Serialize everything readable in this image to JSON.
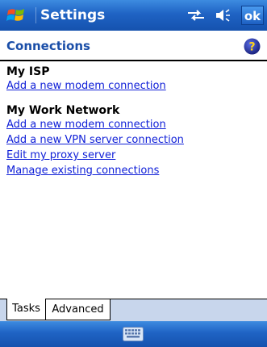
{
  "titlebar": {
    "title": "Settings",
    "start_icon": "windows-flag-icon",
    "ok_label": "ok"
  },
  "header": {
    "title": "Connections",
    "help_icon": "help-icon"
  },
  "groups": [
    {
      "title": "My ISP",
      "links": [
        "Add a new modem connection"
      ]
    },
    {
      "title": "My Work Network",
      "links": [
        "Add a new modem connection",
        "Add a new VPN server connection",
        "Edit my proxy server",
        "Manage existing connections"
      ]
    }
  ],
  "tabs": [
    {
      "label": "Tasks",
      "active": true
    },
    {
      "label": "Advanced",
      "active": false
    }
  ],
  "colors": {
    "titlebar": "#1f63c4",
    "link": "#1020d8",
    "header_title": "#1a4ea8",
    "tabbar": "#c8d6ec"
  }
}
